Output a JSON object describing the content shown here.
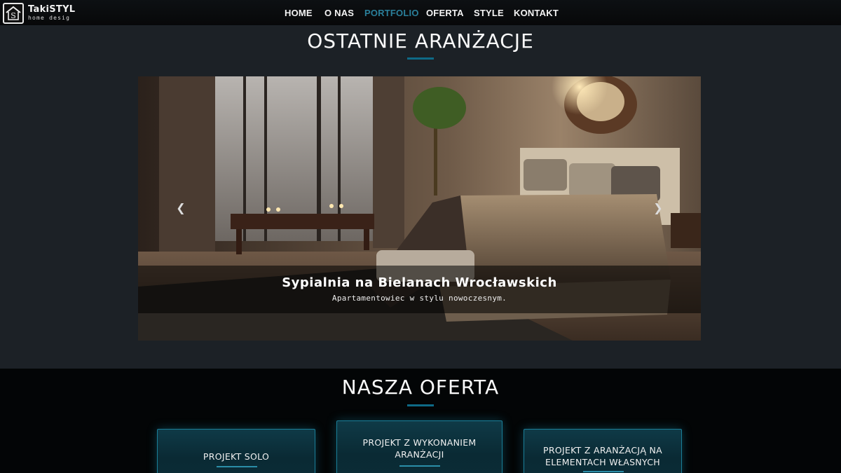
{
  "brand": {
    "name": "TakiSTYL",
    "tagline": "home desig"
  },
  "nav": {
    "items": [
      {
        "label": "HOME",
        "active": false
      },
      {
        "label": "O NAS",
        "active": false
      },
      {
        "label": "PORTFOLIO",
        "active": true
      },
      {
        "label": "OFERTA",
        "active": false
      },
      {
        "label": "STYLE",
        "active": false
      },
      {
        "label": "KONTAKT",
        "active": false
      }
    ]
  },
  "recent": {
    "title": "OSTATNIE ARANŻACJE",
    "slide": {
      "title": "Sypialnia na Bielanach Wrocławskich",
      "subtitle": "Apartamentowiec w stylu nowoczesnym."
    },
    "prev_icon": "chevron-left-icon",
    "next_icon": "chevron-right-icon",
    "indicator_count": 3,
    "active_indicator": 2
  },
  "offer": {
    "title": "NASZA OFERTA",
    "cards": [
      {
        "label": "PROJEKT SOLO"
      },
      {
        "label": "PROJEKT Z WYKONANIEM ARANŻACJI"
      },
      {
        "label": "PROJEKT Z ARANŻACJĄ NA ELEMENTACH WŁASNYCH"
      }
    ]
  },
  "colors": {
    "accent": "#0e6a86",
    "active_nav": "#2a7f9a",
    "section_bg": "#1c2126"
  }
}
